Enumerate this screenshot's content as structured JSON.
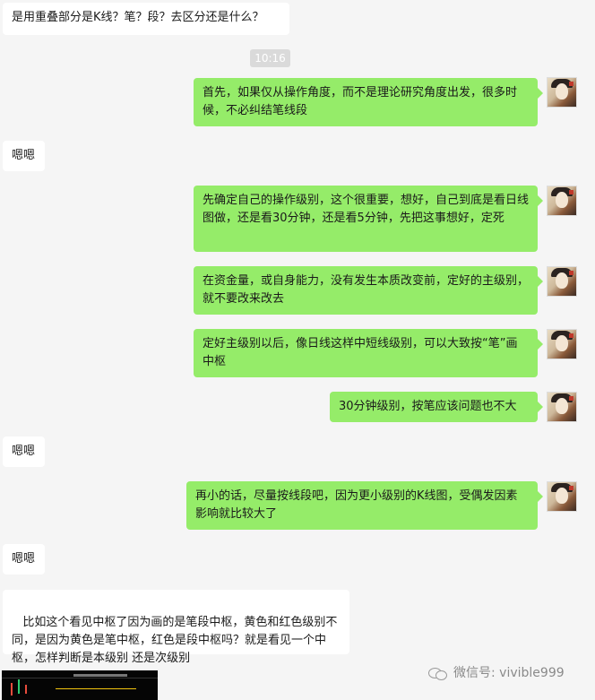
{
  "messages": [
    {
      "side": "left",
      "text": "是用重叠部分是K线？笔？段？去区分还是什么？"
    },
    {
      "side": "right",
      "text": "首先，如果仅从操作角度，而不是理论研究角度出发，很多时候，不必纠结笔线段"
    },
    {
      "side": "left",
      "text": "嗯嗯"
    },
    {
      "side": "right",
      "text": "先确定自己的操作级别，这个很重要，想好，自己到底是看日线图做，还是看30分钟，还是看5分钟，先把这事想好，定死"
    },
    {
      "side": "right",
      "text": "在资金量，或自身能力，没有发生本质改变前，定好的主级别，就不要改来改去"
    },
    {
      "side": "right",
      "text": "定好主级别以后，像日线这样中短线级别，可以大致按“笔”画中枢"
    },
    {
      "side": "right",
      "text": "30分钟级别，按笔应该问题也不大"
    },
    {
      "side": "left",
      "text": "嗯嗯"
    },
    {
      "side": "right",
      "text": "再小的话，尽量按线段吧，因为更小级别的K线图，受偶发因素影响就比较大了"
    },
    {
      "side": "left",
      "text": "嗯嗯"
    },
    {
      "side": "left",
      "text": " 比如这个看见中枢了因为画的是笔段中枢，黄色和红色级别不同，是因为黄色是笔中枢，红色是段中枢吗？就是看见一个中枢，怎样判断是本级别 还是次级别"
    }
  ],
  "timestamp": "10:16",
  "watermark": "微信号: vivible999",
  "icons": {
    "avatar": "avatar-portrait",
    "watermark": "wechat-icon"
  },
  "colors": {
    "sent_bubble": "#95ec69",
    "received_bubble": "#ffffff",
    "background": "#f5f5f5"
  }
}
